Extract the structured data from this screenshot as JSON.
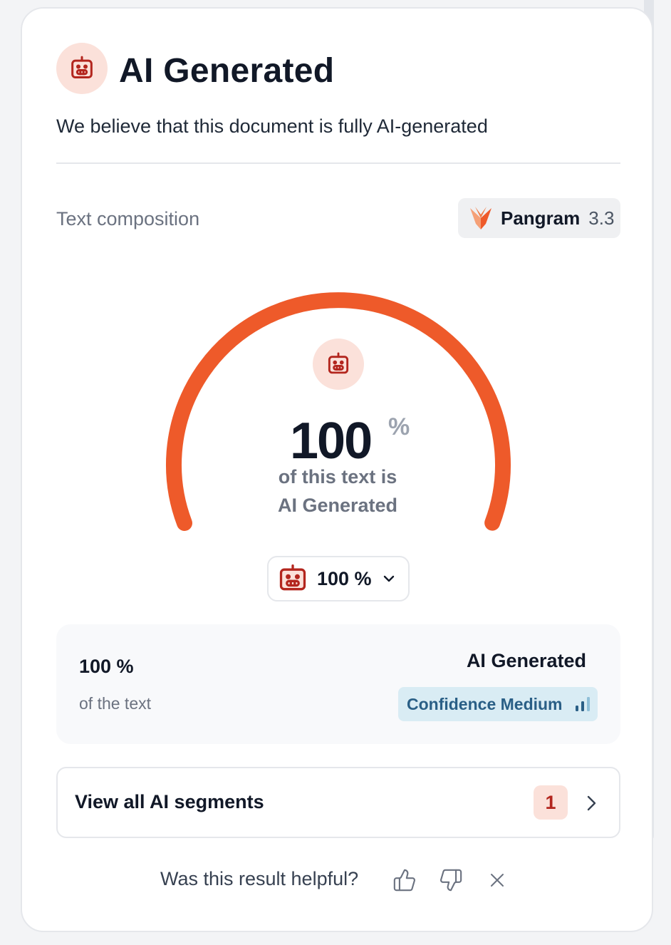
{
  "header": {
    "title": "AI Generated",
    "subtitle": "We believe that this document is fully AI-generated",
    "icon": "robot-icon"
  },
  "composition": {
    "label": "Text composition",
    "model_name": "Pangram",
    "model_version": "3.3"
  },
  "gauge": {
    "value": "100",
    "unit": "%",
    "fraction": 1.0,
    "caption_line1": "of this text is",
    "caption_line2": "AI Generated"
  },
  "dropdown": {
    "value": "100 %"
  },
  "result": {
    "percent": "100 %",
    "percent_sub": "of the text",
    "label": "AI Generated",
    "confidence": "Confidence Medium",
    "confidence_level": 2
  },
  "segments": {
    "label": "View all AI segments",
    "count": "1"
  },
  "feedback": {
    "question": "Was this result helpful?"
  },
  "colors": {
    "accent": "#ee5a2a",
    "robot": "#b3261e",
    "robot_bg": "#fbe1da",
    "confidence_bg": "#d9ecf4",
    "confidence_fg": "#2a5f86"
  }
}
